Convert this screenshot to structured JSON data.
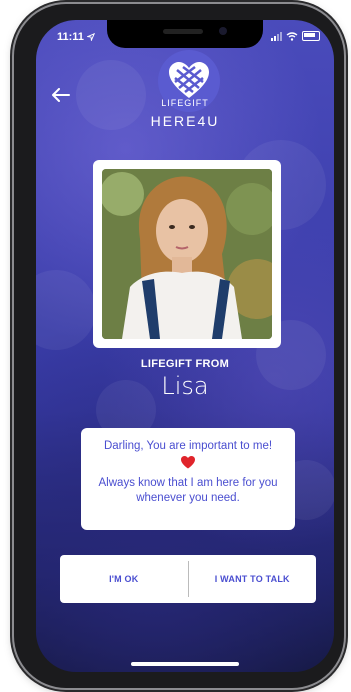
{
  "status_bar": {
    "time": "11:11"
  },
  "header": {
    "logo_text": "LIFEGIFT",
    "app_name": "HERE4U"
  },
  "gift": {
    "from_label": "LIFEGIFT FROM",
    "sender_name": "Lisa",
    "message_line1": "Darling, You are important to me!",
    "message_line2": "Always know that I am here for you whenever you need.",
    "heart_emoji": "heart-icon"
  },
  "actions": {
    "ok_label": "I'M OK",
    "talk_label": "I WANT TO TALK"
  },
  "colors": {
    "accent": "#4a4ed0",
    "background_top": "#4a4bbb",
    "background_bottom": "#111536",
    "heart": "#e0242b"
  }
}
